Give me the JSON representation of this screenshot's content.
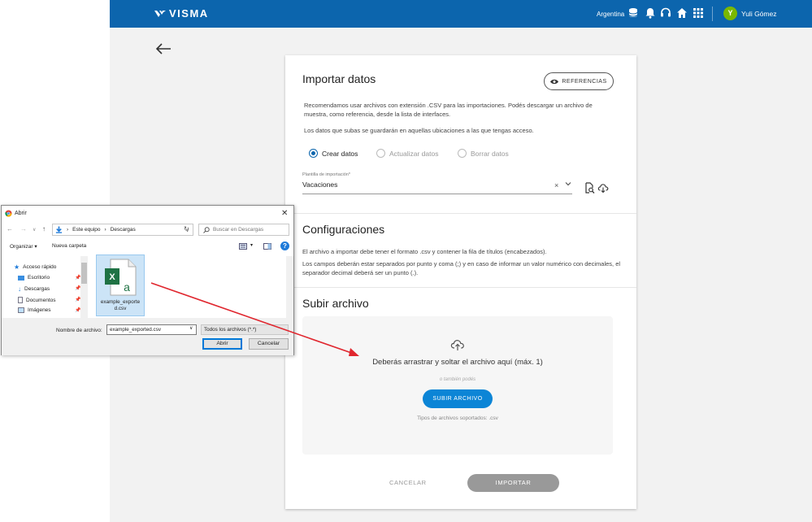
{
  "topbar": {
    "brand": "VISMA",
    "country": "Argentina",
    "avatar_initial": "Y",
    "user_name": "Yuli Gómez",
    "colors": {
      "bar": "#0c65ad",
      "avatar": "#7ab800"
    }
  },
  "import": {
    "title": "Importar datos",
    "references_label": "REFERENCIAS",
    "desc1": "Recomendamos usar archivos con extensión .CSV para las importaciones. Podés descargar un archivo de muestra, como referencia, desde la lista de interfaces.",
    "desc2": "Los datos que subas se guardarán en aquellas ubicaciones a las que tengas acceso.",
    "radios": [
      {
        "label": "Crear datos",
        "selected": true
      },
      {
        "label": "Actualizar datos",
        "selected": false
      },
      {
        "label": "Borrar datos",
        "selected": false
      }
    ],
    "template_label": "Plantilla de importación*",
    "template_value": "Vacaciones"
  },
  "config": {
    "title": "Configuraciones",
    "text1": "El archivo a importar debe tener el formato .csv y contener la fila de títulos (encabezados).",
    "text2": "Los campos deberán estar separados por punto y coma (;) y en caso de informar un valor numérico con decimales, el separador decimal deberá ser un punto (.)."
  },
  "upload": {
    "title": "Subir archivo",
    "drop_text": "Deberás arrastrar y soltar el archivo aquí (máx. 1)",
    "or_text": "o también podés",
    "button": "SUBIR ARCHIVO",
    "types": "Tipos de archivos soportados: .csv"
  },
  "actions": {
    "cancel": "CANCELAR",
    "import": "IMPORTAR"
  },
  "dialog": {
    "title": "Abrir",
    "path": [
      "Este equipo",
      "Descargas"
    ],
    "search_placeholder": "Buscar en Descargas",
    "organize": "Organizar ▾",
    "new_folder": "Nueva carpeta",
    "tree": [
      "Acceso rápido",
      "Escritorio",
      "Descargas",
      "Documentos",
      "Imágenes"
    ],
    "file_name_display": "example_exporte d.csv",
    "name_label": "Nombre de archivo:",
    "name_value": "example_exported.csv",
    "filter": "Todos los archivos (*.*)",
    "open": "Abrir",
    "cancel": "Cancelar"
  }
}
